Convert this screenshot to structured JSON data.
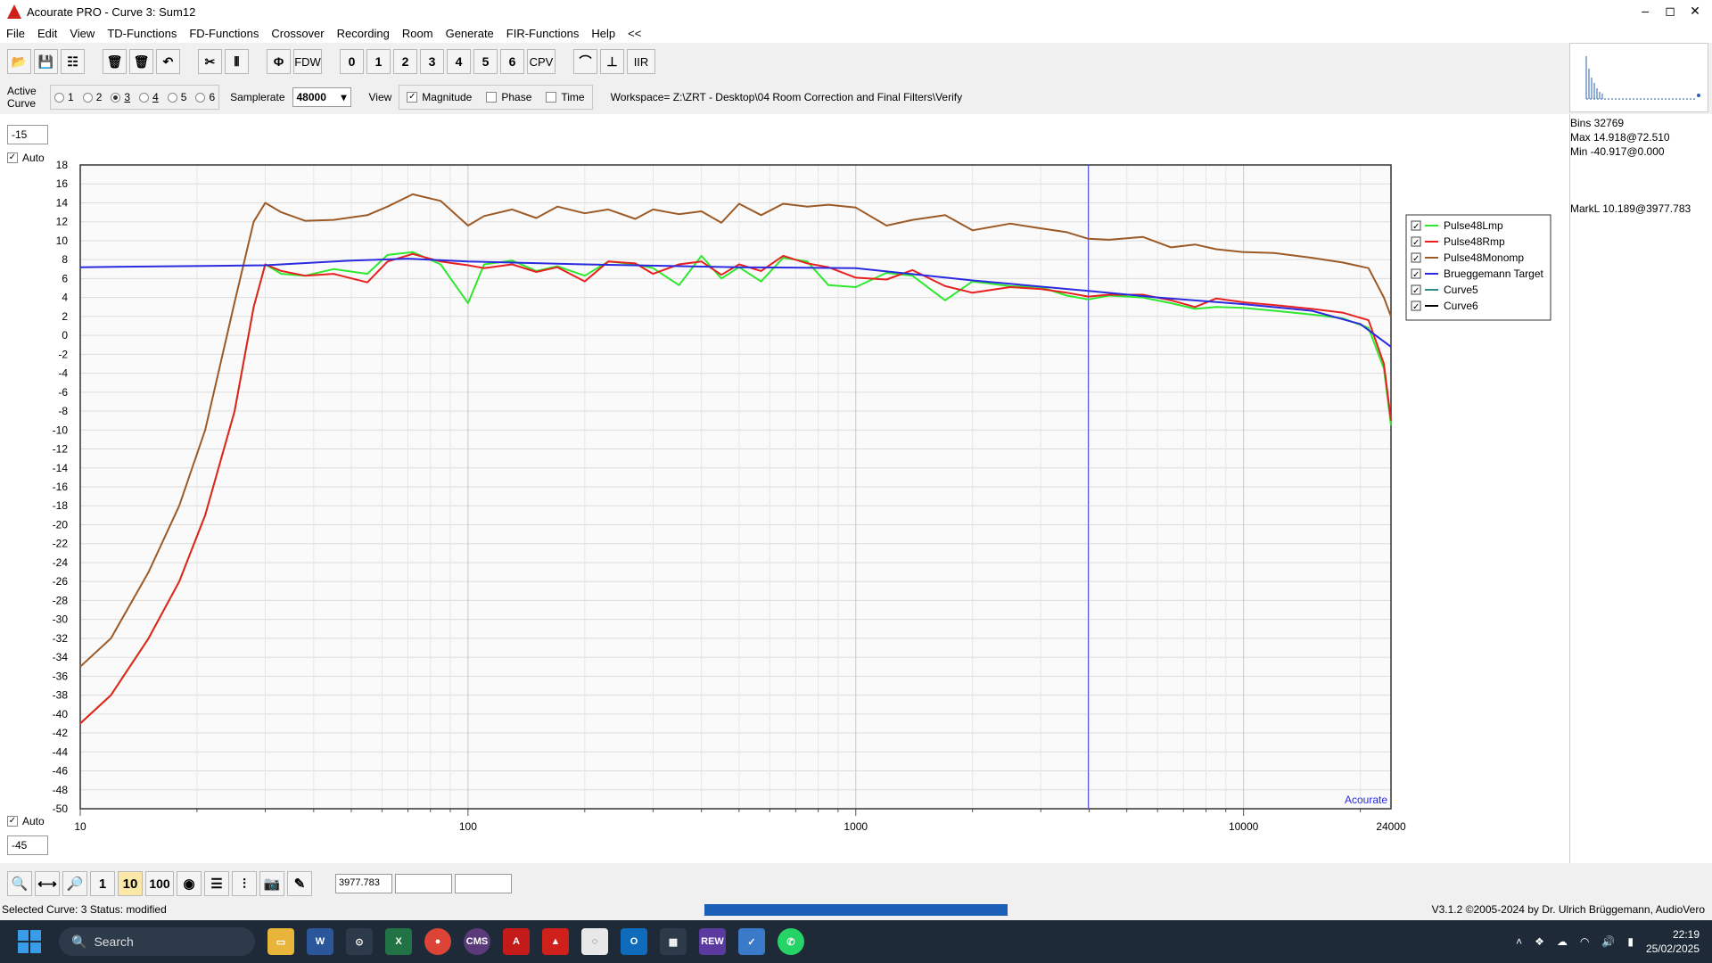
{
  "window": {
    "title": "Acourate PRO - Curve 3: Sum12"
  },
  "menu": [
    "File",
    "Edit",
    "View",
    "TD-Functions",
    "FD-Functions",
    "Crossover",
    "Recording",
    "Room",
    "Generate",
    "FIR-Functions",
    "Help",
    "<<"
  ],
  "toolbar": {
    "phi": "Φ",
    "fdw": "FDW",
    "curve_buttons": [
      "0",
      "1",
      "2",
      "3",
      "4",
      "5",
      "6"
    ],
    "cpv": "CPV",
    "iir": "IIR"
  },
  "curve_select": {
    "label": "Active Curve",
    "options": [
      "1",
      "2",
      "3",
      "4",
      "5",
      "6"
    ],
    "selected": "3"
  },
  "samplerate": {
    "label": "Samplerate",
    "value": "48000"
  },
  "view": {
    "label": "View",
    "magnitude": "Magnitude",
    "magnitude_checked": true,
    "phase": "Phase",
    "phase_checked": false,
    "time": "Time",
    "time_checked": false
  },
  "workspace": "Workspace=  Z:\\ZRT - Desktop\\04 Room Correction and Final Filters\\Verify",
  "side_info": {
    "bins": "Bins 32769",
    "max": "Max 14.918@72.510",
    "min": "Min -40.917@0.000",
    "markl": "MarkL 10.189@3977.783"
  },
  "axis_top": {
    "value": "-15",
    "auto_label": "Auto",
    "auto_checked": true
  },
  "axis_bottom": {
    "value": "-45",
    "auto_label": "Auto",
    "auto_checked": true
  },
  "bottom_toolbar": {
    "b1": "1",
    "b10": "10",
    "b100": "100",
    "marker_value": "3977.783"
  },
  "status": {
    "left": "Selected Curve: 3   Status: modified",
    "right": "V3.1.2 ©2005-2024 by Dr. Ulrich Brüggemann, AudioVero",
    "progress": 1.0
  },
  "taskbar": {
    "search": "Search",
    "time": "22:19",
    "date": "25/02/2025",
    "apps": [
      "W",
      "X",
      "CMS",
      "REW"
    ]
  },
  "chart_data": {
    "type": "line",
    "xscale": "log",
    "xlim": [
      10,
      24000
    ],
    "ylim": [
      -50,
      18
    ],
    "x_ticks": [
      "10",
      "100",
      "1000",
      "10000",
      "24000"
    ],
    "y_ticks": [
      18,
      16,
      14,
      12,
      10,
      8,
      6,
      4,
      2,
      0,
      -2,
      -4,
      -6,
      -8,
      -10,
      -12,
      -14,
      -16,
      -18,
      -20,
      -22,
      -24,
      -26,
      -28,
      -30,
      -32,
      -34,
      -36,
      -38,
      -40,
      -42,
      -44,
      -46,
      -48,
      -50
    ],
    "watermark": "Acourate",
    "marker_x": 3977.783,
    "grid": true,
    "legend_position": "right",
    "series": [
      {
        "name": "Pulse48Lmp",
        "color": "#2ee82e",
        "x": [
          10,
          12,
          15,
          18,
          21,
          25,
          28,
          30,
          33,
          38,
          45,
          55,
          62,
          72,
          85,
          100,
          110,
          130,
          150,
          170,
          200,
          230,
          270,
          300,
          350,
          400,
          450,
          500,
          570,
          650,
          750,
          850,
          1000,
          1200,
          1400,
          1700,
          2000,
          2500,
          3000,
          3500,
          3978,
          4500,
          5500,
          6500,
          7500,
          8500,
          10000,
          12000,
          15000,
          18000,
          21000,
          23000,
          24000
        ],
        "y": [
          -41,
          -38,
          -32,
          -26,
          -19,
          -8,
          3,
          7.5,
          6.5,
          6.3,
          7,
          6.5,
          8.5,
          8.8,
          7.5,
          3.4,
          7.5,
          7.9,
          6.8,
          7.3,
          6.3,
          7.8,
          7.5,
          7.1,
          5.3,
          8.4,
          6,
          7.2,
          5.7,
          8.2,
          7.8,
          5.3,
          5.1,
          6.6,
          6.3,
          3.7,
          5.7,
          5.2,
          5.1,
          4.2,
          3.8,
          4.2,
          4,
          3.4,
          2.8,
          3,
          2.9,
          2.6,
          2.2,
          1.8,
          0.8,
          -3.5,
          -9.5
        ]
      },
      {
        "name": "Pulse48Rmp",
        "color": "#e82020",
        "x": [
          10,
          12,
          15,
          18,
          21,
          25,
          28,
          30,
          33,
          38,
          45,
          55,
          62,
          72,
          85,
          100,
          110,
          130,
          150,
          170,
          200,
          230,
          270,
          300,
          350,
          400,
          450,
          500,
          570,
          650,
          750,
          850,
          1000,
          1200,
          1400,
          1700,
          2000,
          2500,
          3000,
          3500,
          3978,
          4500,
          5500,
          6500,
          7500,
          8500,
          10000,
          12000,
          15000,
          18000,
          21000,
          23000,
          24000
        ],
        "y": [
          -41,
          -38,
          -32,
          -26,
          -19,
          -8,
          3,
          7.5,
          6.8,
          6.3,
          6.5,
          5.6,
          7.8,
          8.6,
          7.8,
          7.4,
          7.1,
          7.5,
          6.7,
          7.2,
          5.7,
          7.8,
          7.6,
          6.5,
          7.5,
          7.8,
          6.4,
          7.5,
          6.8,
          8.4,
          7.6,
          7.2,
          6.1,
          5.9,
          6.9,
          5.2,
          4.5,
          5.1,
          4.9,
          4.5,
          4.1,
          4.3,
          4.3,
          3.7,
          3,
          3.9,
          3.5,
          3.2,
          2.8,
          2.4,
          1.6,
          -3,
          -9
        ]
      },
      {
        "name": "Pulse48Monomp",
        "color": "#9c5a26",
        "x": [
          10,
          12,
          15,
          18,
          21,
          25,
          28,
          30,
          33,
          38,
          45,
          55,
          62,
          72,
          85,
          100,
          110,
          130,
          150,
          170,
          200,
          230,
          270,
          300,
          350,
          400,
          450,
          500,
          570,
          650,
          750,
          850,
          1000,
          1200,
          1400,
          1700,
          2000,
          2500,
          3000,
          3500,
          3978,
          4500,
          5500,
          6500,
          7500,
          8500,
          10000,
          12000,
          15000,
          18000,
          21000,
          23000,
          24000
        ],
        "y": [
          -35,
          -32,
          -25,
          -18,
          -10,
          3.5,
          12,
          14,
          13,
          12.1,
          12.2,
          12.7,
          13.6,
          14.9,
          14.2,
          11.6,
          12.6,
          13.3,
          12.4,
          13.6,
          12.9,
          13.3,
          12.3,
          13.3,
          12.8,
          13.1,
          11.9,
          13.9,
          12.7,
          13.9,
          13.6,
          13.8,
          13.5,
          11.6,
          12.2,
          12.7,
          11.1,
          11.8,
          11.3,
          10.9,
          10.2,
          10.1,
          10.4,
          9.3,
          9.6,
          9.1,
          8.8,
          8.7,
          8.2,
          7.7,
          7.1,
          4,
          2
        ]
      },
      {
        "name": "Brueggemann Target",
        "color": "#2a2ae0",
        "x": [
          10,
          30,
          50,
          70,
          100,
          200,
          500,
          1000,
          2000,
          3978,
          6000,
          10000,
          15000,
          20000,
          24000
        ],
        "y": [
          7.2,
          7.4,
          7.9,
          8.1,
          7.8,
          7.5,
          7.2,
          7.1,
          5.8,
          4.7,
          4,
          3.3,
          2.6,
          1.2,
          -1.2
        ]
      },
      {
        "name": "Curve5",
        "color": "#2e8b8b",
        "x": [],
        "y": []
      },
      {
        "name": "Curve6",
        "color": "#000000",
        "x": [],
        "y": []
      }
    ]
  }
}
